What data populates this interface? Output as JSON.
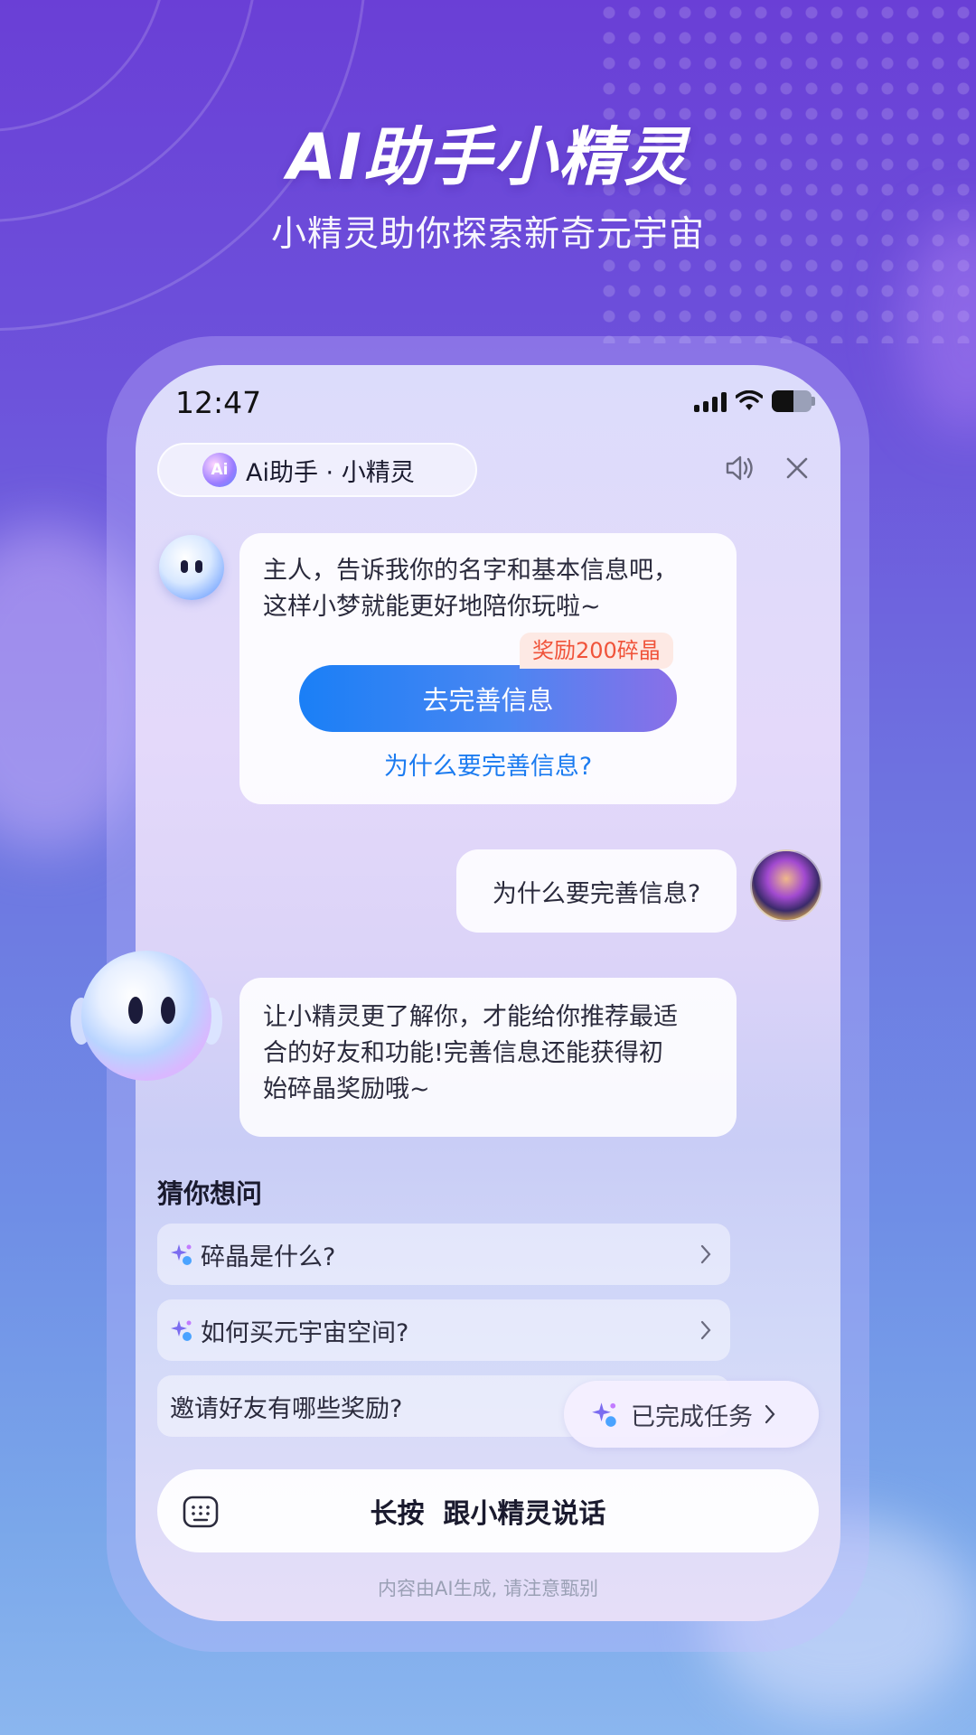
{
  "hero": {
    "title": "AI助手小精灵",
    "subtitle": "小精灵助你探索新奇元宇宙"
  },
  "status_bar": {
    "time": "12:47"
  },
  "header": {
    "badge": "Ai",
    "title": "Ai助手 · 小精灵"
  },
  "messages": {
    "bot_1": {
      "line_1": "主人，告诉我你的名字和基本信息吧，",
      "line_2": "这样小梦就能更好地陪你玩啦~",
      "reward_tag": "奖励200碎晶",
      "cta_label": "去完善信息",
      "link_label": "为什么要完善信息?"
    },
    "user_1": "为什么要完善信息?",
    "bot_2": {
      "line_1": "让小精灵更了解你，才能给你推荐最适",
      "line_2": "合的好友和功能!完善信息还能获得初",
      "line_3": "始碎晶奖励哦~"
    }
  },
  "suggestions": {
    "title": "猜你想问",
    "items": [
      {
        "label": "碎晶是什么?"
      },
      {
        "label": "如何买元宇宙空间?"
      },
      {
        "label": "邀请好友有哪些奖励?"
      }
    ]
  },
  "task_pill": {
    "label": "已完成任务"
  },
  "voice_bar": {
    "label": "长按  跟小精灵说话"
  },
  "disclaimer": "内容由AI生成, 请注意甄别",
  "colors": {
    "primary_blue": "#1b7bf0",
    "reward_red": "#f0533a",
    "background_purple": "#6a3fd6"
  }
}
